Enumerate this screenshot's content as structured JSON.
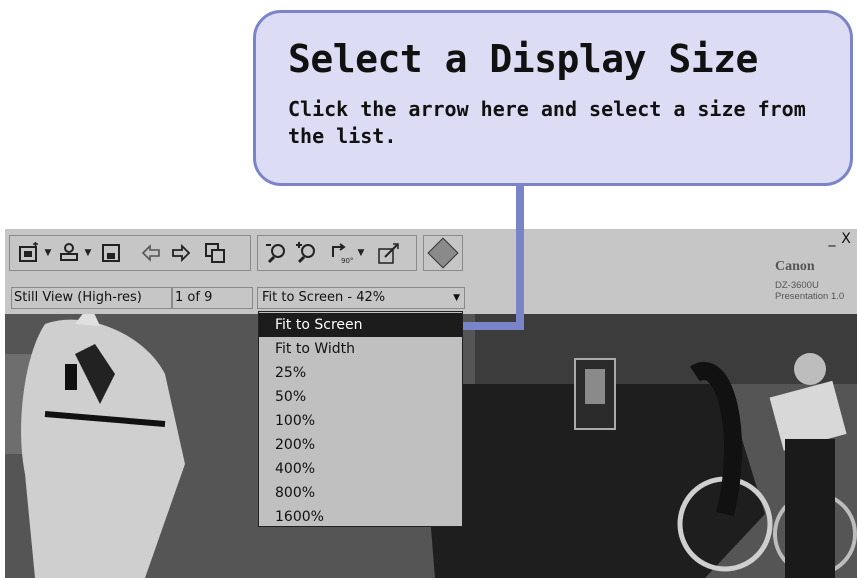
{
  "callout": {
    "title": "Select a Display Size",
    "body": "Click the arrow here and select a size from the list."
  },
  "window": {
    "minimize": "_",
    "close": "X",
    "brand": "Canon",
    "model_line1": "DZ-3600U",
    "model_line2": "Presentation 1.0"
  },
  "status": {
    "mode": "Still View (High-res)",
    "count": "1 of 9"
  },
  "size_select": {
    "value": "Fit to Screen - 42%"
  },
  "dropdown": {
    "options": [
      "Fit to Screen",
      "Fit to Width",
      "25%",
      "50%",
      "100%",
      "200%",
      "400%",
      "800%",
      "1600%"
    ],
    "selected_index": 0
  },
  "toolbar_icons": [
    "capture-icon",
    "stamp-icon",
    "save-icon",
    "previous-icon",
    "next-icon",
    "copy-icon",
    "zoom-out-icon",
    "zoom-in-icon",
    "rotate-90-icon",
    "draw-icon",
    "help-icon"
  ]
}
